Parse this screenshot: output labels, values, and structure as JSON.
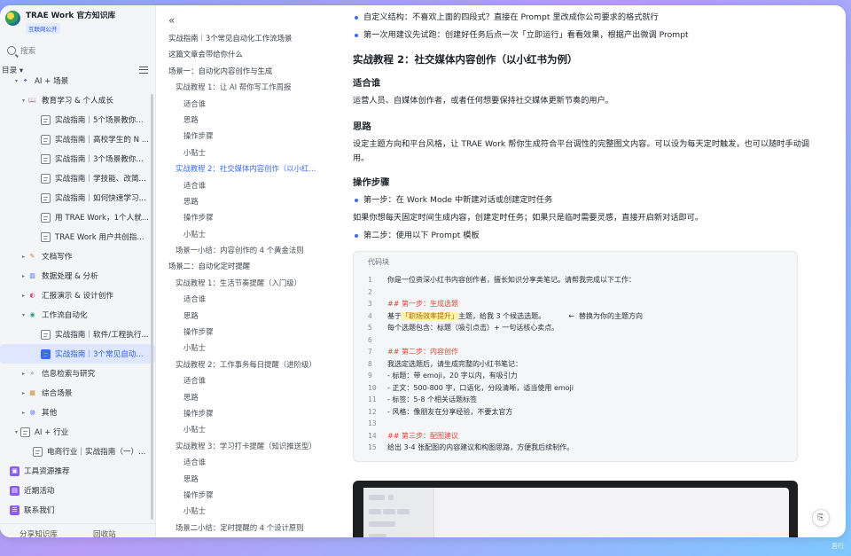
{
  "sidebar": {
    "kb_title": "TRAE Work 官方知识库",
    "kb_badge": "互联网公开",
    "search_placeholder": "搜索",
    "toc_label": "目录",
    "items": [
      {
        "label": "AI + 场景",
        "level": 1,
        "caret": "▾",
        "icon": "ai-icon"
      },
      {
        "label": "教育学习 & 个人成长",
        "level": 2,
        "caret": "▾",
        "icon": "book-icon"
      },
      {
        "label": "实战指南｜5个场景教你...",
        "level": 3,
        "icon": "doc-icon"
      },
      {
        "label": "实战指南｜高校学生的 N ...",
        "level": 3,
        "icon": "doc-icon"
      },
      {
        "label": "实战指南｜3个场景教你...",
        "level": 3,
        "icon": "doc-icon"
      },
      {
        "label": "实战指南｜学技能、改简...",
        "level": 3,
        "icon": "doc-icon"
      },
      {
        "label": "实战指南｜如何快速学习...",
        "level": 3,
        "icon": "doc-icon"
      },
      {
        "label": "用 TRAE Work，1个人就...",
        "level": 3,
        "icon": "doc-icon"
      },
      {
        "label": "TRAE Work 用户共创指...",
        "level": 3,
        "icon": "doc-icon"
      },
      {
        "label": "文档写作",
        "level": 2,
        "caret": "▸",
        "icon": "pen-icon"
      },
      {
        "label": "数据处理 & 分析",
        "level": 2,
        "caret": "▸",
        "icon": "chart-icon"
      },
      {
        "label": "汇报演示 & 设计创作",
        "level": 2,
        "caret": "▸",
        "icon": "palette-icon"
      },
      {
        "label": "工作流自动化",
        "level": 2,
        "caret": "▾",
        "icon": "robot-icon"
      },
      {
        "label": "实战指南｜软件/工程执行...",
        "level": 3,
        "icon": "doc-icon"
      },
      {
        "label": "实战指南｜3个常见自动...",
        "level": 3,
        "icon": "doc-icon",
        "active": true
      },
      {
        "label": "信息检索与研究",
        "level": 2,
        "caret": "▸",
        "icon": "magnifier-icon"
      },
      {
        "label": "综合场景",
        "level": 2,
        "caret": "▸",
        "icon": "grid-icon"
      },
      {
        "label": "其他",
        "level": 2,
        "caret": "▸",
        "icon": "globe-icon"
      },
      {
        "label": "AI + 行业",
        "level": 1,
        "caret": "▾",
        "icon": "doc-icon"
      },
      {
        "label": "电商行业｜实战指南（一）...",
        "level": 2,
        "icon": "doc-icon"
      },
      {
        "label": "工具资源推荐",
        "level": 0,
        "icon": "box-icon"
      },
      {
        "label": "近期活动",
        "level": 0,
        "icon": "calendar-icon"
      },
      {
        "label": "联系我们",
        "level": 0,
        "icon": "contact-icon"
      }
    ],
    "footer": {
      "share": "分享知识库",
      "trash": "回收站"
    }
  },
  "outline": {
    "items": [
      {
        "label": "实战指南｜3个常见自动化工作流场景",
        "level": 1
      },
      {
        "label": "这篇文章会带给你什么",
        "level": 1
      },
      {
        "label": "场景一：自动化内容创作与生成",
        "level": 1
      },
      {
        "label": "实战教程 1：让 AI 帮你写工作周报",
        "level": 2
      },
      {
        "label": "适合谁",
        "level": 3
      },
      {
        "label": "思路",
        "level": 3
      },
      {
        "label": "操作步骤",
        "level": 3
      },
      {
        "label": "小贴士",
        "level": 3
      },
      {
        "label": "实战教程 2：社交媒体内容创作（以小红...",
        "level": 2,
        "active": true
      },
      {
        "label": "适合谁",
        "level": 3
      },
      {
        "label": "思路",
        "level": 3
      },
      {
        "label": "操作步骤",
        "level": 3
      },
      {
        "label": "小贴士",
        "level": 3
      },
      {
        "label": "场景一小结：内容创作的 4 个黄金法则",
        "level": 2
      },
      {
        "label": "场景二：自动化定时提醒",
        "level": 1
      },
      {
        "label": "实战教程 1：生活节奏提醒（入门级）",
        "level": 2
      },
      {
        "label": "适合谁",
        "level": 3
      },
      {
        "label": "思路",
        "level": 3
      },
      {
        "label": "操作步骤",
        "level": 3
      },
      {
        "label": "小贴士",
        "level": 3
      },
      {
        "label": "实战教程 2：工作事务每日提醒（进阶级）",
        "level": 2
      },
      {
        "label": "适合谁",
        "level": 3
      },
      {
        "label": "思路",
        "level": 3
      },
      {
        "label": "操作步骤",
        "level": 3
      },
      {
        "label": "小贴士",
        "level": 3
      },
      {
        "label": "实战教程 3：学习打卡提醒（知识推送型）",
        "level": 2
      },
      {
        "label": "适合谁",
        "level": 3
      },
      {
        "label": "思路",
        "level": 3
      },
      {
        "label": "操作步骤",
        "level": 3
      },
      {
        "label": "小贴士",
        "level": 3
      },
      {
        "label": "场景二小结：定时提醒的 4 个设计原则",
        "level": 2
      }
    ]
  },
  "content": {
    "bullet1": "自定义结构：不喜欢上面的四段式？直接在 Prompt 里改成你公司要求的格式就行",
    "bullet2": "第一次用建议先试跑：创建好任务后点一次「立即运行」看看效果，根据产出微调 Prompt",
    "h2": "实战教程 2：社交媒体内容创作（以小红书为例）",
    "h3_who": "适合谁",
    "p_who": "运营人员、自媒体创作者，或者任何想要保持社交媒体更新节奏的用户。",
    "h3_idea": "思路",
    "p_idea": "设定主题方向和平台风格，让 TRAE Work 帮你生成符合平台调性的完整图文内容。可以设为每天定时触发，也可以随时手动调用。",
    "h3_steps": "操作步骤",
    "step1": "第一步：在 Work Mode 中新建对话或创建定时任务",
    "p_step": "如果你想每天固定时间生成内容，创建定时任务；如果只是临时需要灵感，直接开启新对话即可。",
    "step2": "第二步：使用以下 Prompt 模板",
    "code_title": "代码块",
    "code": [
      {
        "n": "1",
        "t": "你是一位资深小红书内容创作者，擅长知识分享类笔记。请帮我完成以下工作："
      },
      {
        "n": "2",
        "t": ""
      },
      {
        "n": "3",
        "t": "## 第一步：生成选题",
        "red": true
      },
      {
        "n": "4",
        "pre": "基于",
        "hl": "「职场效率提升」",
        "post": "主题，给我 3 个候选选题。",
        "note": "←  替换为你的主题方向"
      },
      {
        "n": "5",
        "t": "每个选题包含：标题（吸引点击）+ 一句话核心卖点。"
      },
      {
        "n": "6",
        "t": ""
      },
      {
        "n": "7",
        "t": "## 第二步：内容创作",
        "red": true
      },
      {
        "n": "8",
        "t": "我选定选题后，请生成完整的小红书笔记："
      },
      {
        "n": "9",
        "t": "- 标题：带 emoji，20 字以内，有吸引力"
      },
      {
        "n": "10",
        "t": "- 正文：500-800 字，口语化，分段清晰，适当使用 emoji"
      },
      {
        "n": "11",
        "t": "- 标签：5-8 个相关话题标签"
      },
      {
        "n": "12",
        "t": "- 风格：像朋友在分享经验，不要太官方"
      },
      {
        "n": "13",
        "t": ""
      },
      {
        "n": "14",
        "t": "## 第三步：配图建议",
        "red": true
      },
      {
        "n": "15",
        "t": "给出 3-4 张配图的内容建议和构图思路，方便我后续制作。"
      }
    ]
  },
  "watermark": "吾行"
}
